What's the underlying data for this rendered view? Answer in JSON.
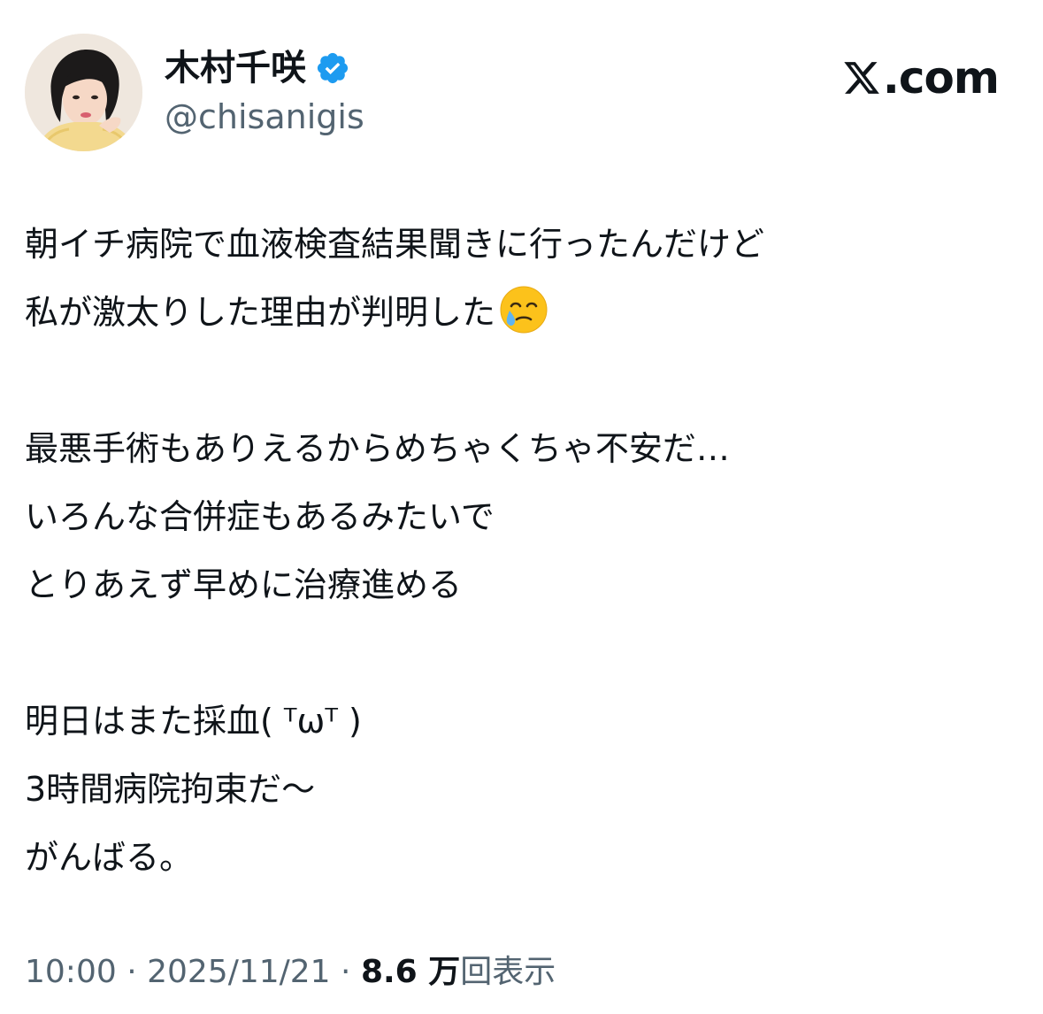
{
  "author": {
    "display_name": "木村千咲",
    "handle": "@chisanigis",
    "verified": true,
    "avatar_icon": "profile-photo"
  },
  "brand": {
    "logo_icon": "x-logo-icon",
    "text": ".com"
  },
  "post": {
    "lines": [
      "朝イチ病院で血液検査結果聞きに行ったんだけど",
      "私が激太りした理由が判明した",
      "",
      "最悪手術もありえるからめちゃくちゃ不安だ…",
      "いろんな合併症もあるみたいで",
      "とりあえず早めに治療進める",
      "",
      "明日はまた採血( ᵀωᵀ )",
      "3時間病院拘束だ〜",
      "がんばる。"
    ],
    "emoji": "face-holding-back-tears-icon"
  },
  "meta": {
    "time": "10:00",
    "separator": " · ",
    "date": "2025/11/21",
    "views_count": "8.6 万",
    "views_label": "回表示"
  },
  "colors": {
    "text_primary": "#0f1419",
    "text_secondary": "#536471",
    "verified_blue": "#1d9bf0"
  }
}
